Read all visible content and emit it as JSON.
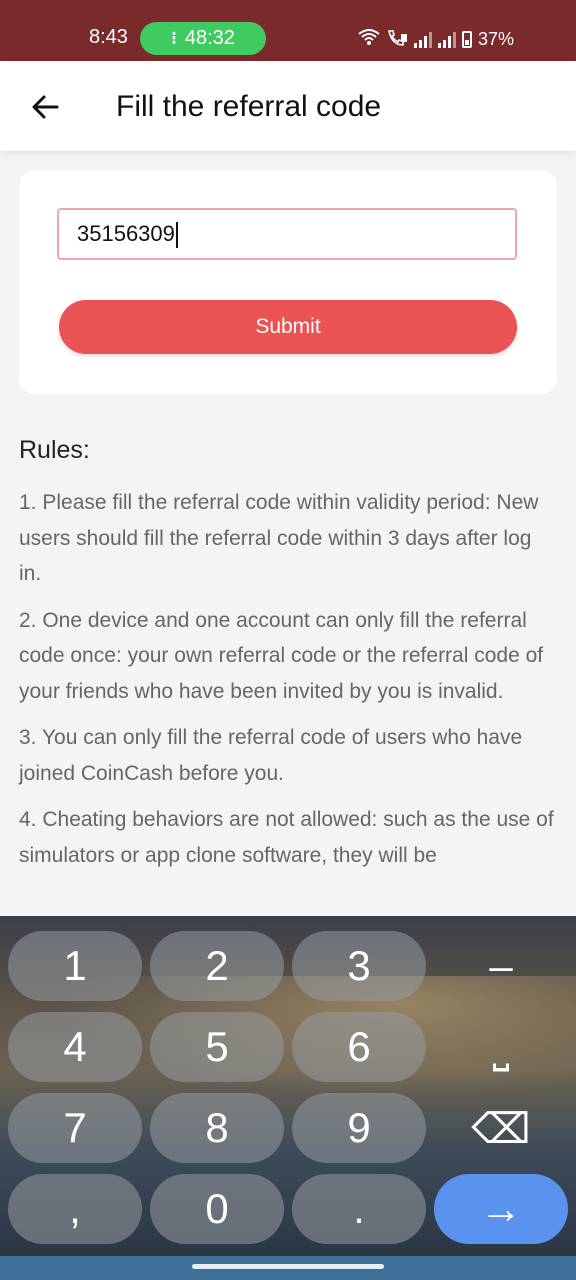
{
  "status_bar": {
    "time": "8:43",
    "call_timer": "48:32",
    "battery": "37%"
  },
  "app_bar": {
    "title": "Fill the referral code"
  },
  "form": {
    "referral_code_value": "35156309",
    "submit_label": "Submit"
  },
  "rules": {
    "title": "Rules:",
    "items": [
      "1. Please fill the referral code within validity period: New users should fill the referral code within 3 days after log in.",
      "2. One device and one account can only fill the referral code once: your own referral code or the referral code of your friends who have been invited by you is invalid.",
      "3. You can only fill the referral code of users who have joined CoinCash before you.",
      "4. Cheating behaviors are not allowed: such as the use of simulators or app clone software, they will be"
    ]
  },
  "keyboard": {
    "keys": [
      "1",
      "2",
      "3",
      "–",
      "4",
      "5",
      "6",
      "⎵",
      "7",
      "8",
      "9",
      "⌫",
      "0",
      ".",
      "→"
    ],
    "comma": ","
  },
  "colors": {
    "status_bar": "#7a2a2a",
    "timer_pill": "#3fcb62",
    "submit": "#ea5253",
    "input_border": "#f0a6a6",
    "go_key": "#5a93ee"
  }
}
